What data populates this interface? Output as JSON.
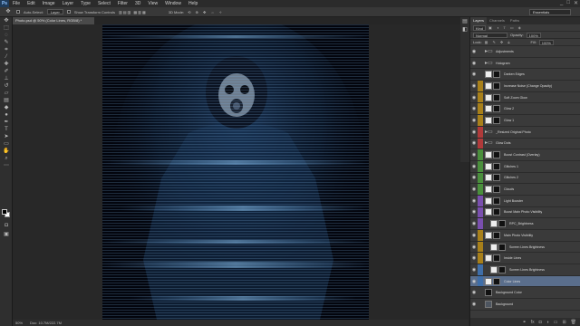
{
  "menu": [
    "File",
    "Edit",
    "Image",
    "Layer",
    "Type",
    "Select",
    "Filter",
    "3D",
    "View",
    "Window",
    "Help"
  ],
  "window_controls": [
    "_",
    "□",
    "✕"
  ],
  "options": {
    "auto_select_label": "Auto-Select:",
    "auto_select_value": "Layer",
    "transform_label": "Show Transform Controls",
    "mode_label": "3D Mode:",
    "workspace": "Essentials"
  },
  "document": {
    "tab_title": "Photo.psd @ 50% (Color Lines, RGB/8) *",
    "zoom": "50%",
    "doc_info": "Doc: 10.7M/222.7M"
  },
  "panel": {
    "tabs": [
      "Layers",
      "Channels",
      "Paths"
    ],
    "kind_label": "Kind",
    "blend_mode": "Normal",
    "opacity_label": "Opacity:",
    "opacity_value": "100%",
    "lock_label": "Lock:",
    "fill_label": "Fill:",
    "fill_value": "100%"
  },
  "layers": [
    {
      "name": "Adjustments",
      "color": "#3a3a3a",
      "type": "folder",
      "indent": false
    },
    {
      "name": "Hologram",
      "color": "#3a3a3a",
      "type": "folder",
      "indent": false
    },
    {
      "name": "Darken Edges",
      "color": "#3a3a3a",
      "type": "mask",
      "indent": false
    },
    {
      "name": "Increase Noise (Change Opacity)",
      "color": "#a8801a",
      "type": "mask",
      "indent": false
    },
    {
      "name": "Soft Zoom Glow",
      "color": "#a8801a",
      "type": "mask",
      "indent": false
    },
    {
      "name": "Glow 2",
      "color": "#a8801a",
      "type": "mask",
      "indent": false
    },
    {
      "name": "Glow 1",
      "color": "#a8801a",
      "type": "mask",
      "indent": false
    },
    {
      "name": "_Resized Original Photo",
      "color": "#b03a3a",
      "type": "folder",
      "indent": false
    },
    {
      "name": "Glow Dots",
      "color": "#b03a3a",
      "type": "folder",
      "indent": false
    },
    {
      "name": "Boost Contrast (Overlay)",
      "color": "#4a8f3c",
      "type": "mask",
      "indent": false
    },
    {
      "name": "Glitches 1",
      "color": "#4a8f3c",
      "type": "mask",
      "indent": false
    },
    {
      "name": "Glitches 2",
      "color": "#4a8f3c",
      "type": "mask",
      "indent": false
    },
    {
      "name": "Clouds",
      "color": "#4a8f3c",
      "type": "mask",
      "indent": false
    },
    {
      "name": "Light Booster",
      "color": "#7a4fae",
      "type": "mask",
      "indent": false
    },
    {
      "name": "Boost Main Photo Visibility",
      "color": "#7a4fae",
      "type": "mask",
      "indent": false
    },
    {
      "name": "RPC_Brightness",
      "color": "#7a4fae",
      "type": "mask",
      "indent": true
    },
    {
      "name": "Main Photo Visibility",
      "color": "#a8801a",
      "type": "mask",
      "indent": false
    },
    {
      "name": "Screen Lines Brightness",
      "color": "#a8801a",
      "type": "mask",
      "indent": true
    },
    {
      "name": "Inside Lines",
      "color": "#a8801a",
      "type": "mask",
      "indent": false
    },
    {
      "name": "Screen Lines Brightness",
      "color": "#3f6ea8",
      "type": "mask",
      "indent": true
    },
    {
      "name": "Color Lines",
      "color": "#3f6ea8",
      "type": "mask",
      "indent": false,
      "selected": true
    },
    {
      "name": "Background Color",
      "color": "#3a3a3a",
      "type": "dark",
      "indent": false
    },
    {
      "name": "Background",
      "color": "#3a3a3a",
      "type": "photo",
      "indent": false
    }
  ],
  "footer_icons": [
    "link-icon",
    "fx-icon",
    "mask-icon",
    "adjustment-icon",
    "folder-icon",
    "new-layer-icon",
    "trash-icon"
  ]
}
